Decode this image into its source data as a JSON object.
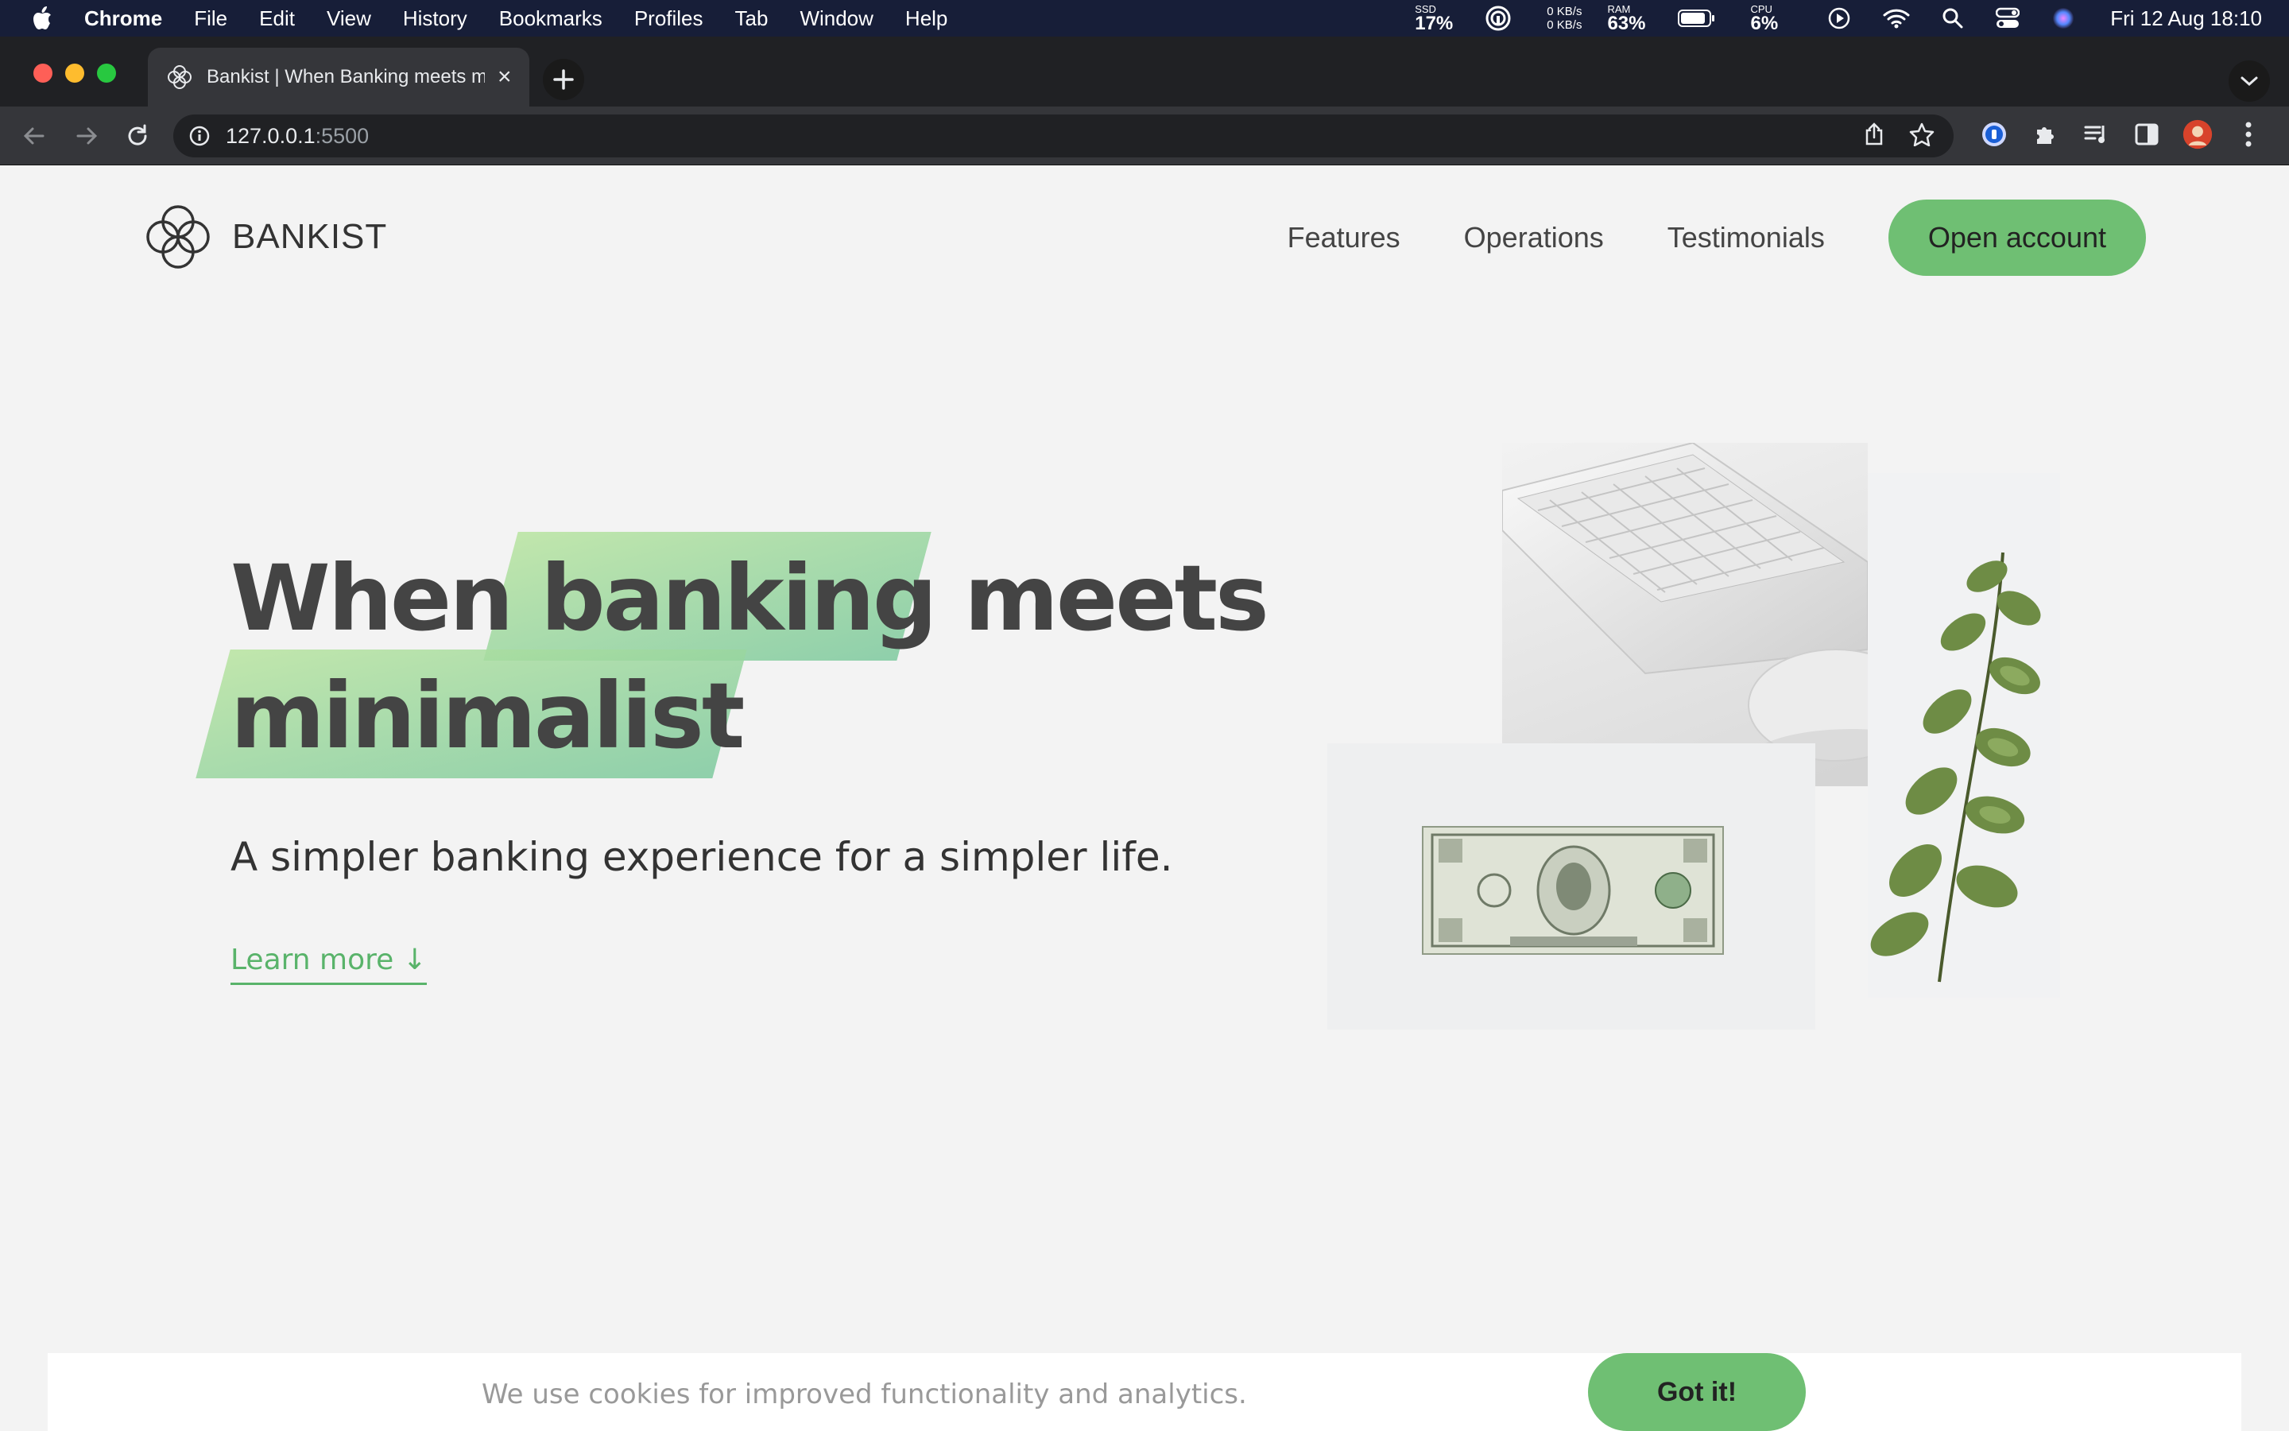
{
  "menubar": {
    "app_name": "Chrome",
    "menus": [
      "File",
      "Edit",
      "View",
      "History",
      "Bookmarks",
      "Profiles",
      "Tab",
      "Window",
      "Help"
    ],
    "ssd_label": "SSD",
    "ssd_value": "17%",
    "net_up": "0 KB/s",
    "net_down": "0 KB/s",
    "ram_label": "RAM",
    "ram_value": "63%",
    "cpu_label": "CPU",
    "cpu_value": "6%",
    "clock": "Fri 12 Aug  18:10"
  },
  "browser": {
    "tab_title": "Bankist | When Banking meets minimalist",
    "url_host": "127.0.0.1",
    "url_port": ":5500"
  },
  "page": {
    "logo_text": "BANKIST",
    "nav": {
      "features": "Features",
      "operations": "Operations",
      "testimonials": "Testimonials",
      "open_account": "Open account"
    },
    "hero": {
      "word_when": "When",
      "word_banking": "banking",
      "word_meets": "meets",
      "word_minimalist": "minimalist",
      "subtitle": "A simpler banking experience for a simpler life.",
      "learn_more": "Learn more ↓"
    },
    "cookie": {
      "message": "We use cookies for improved functionality and analytics.",
      "button": "Got it!"
    }
  },
  "colors": {
    "accent": "#6fbf73",
    "menubar": "#171e38",
    "text": "#444444"
  }
}
